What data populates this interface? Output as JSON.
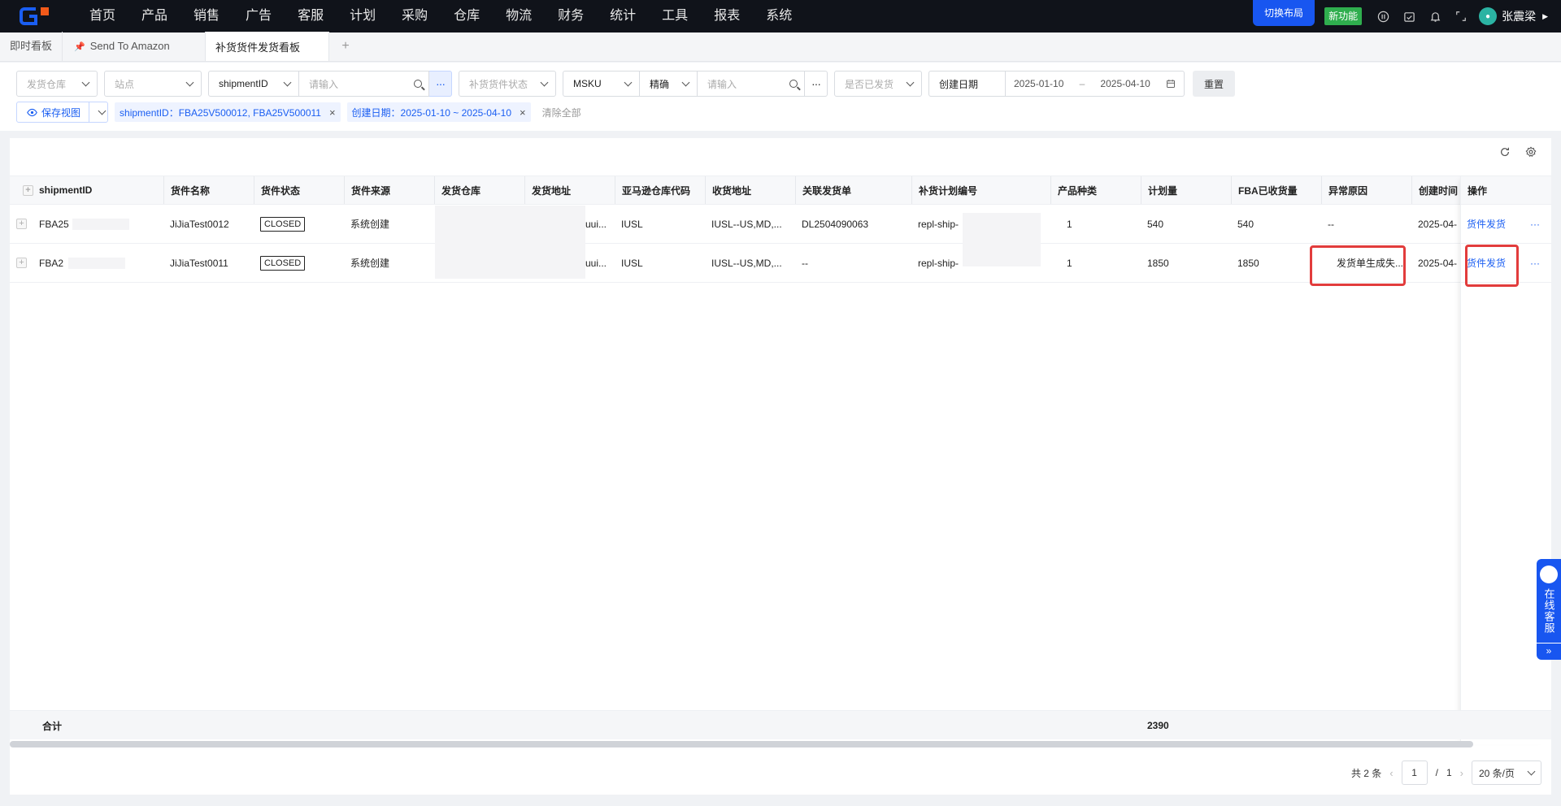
{
  "nav": {
    "items": [
      "首页",
      "产品",
      "销售",
      "广告",
      "客服",
      "计划",
      "采购",
      "仓库",
      "物流",
      "财务",
      "统计",
      "工具",
      "报表",
      "系统"
    ],
    "switch_layout": "切换布局",
    "new_feature": "新功能",
    "user_name": "张震梁"
  },
  "tabs": {
    "items": [
      "即时看板",
      "Send To Amazon",
      "补货货件发货看板"
    ],
    "add": "+"
  },
  "filters": {
    "warehouse_placeholder": "发货仓库",
    "site_placeholder": "站点",
    "shipment_field": "shipmentID",
    "input_placeholder": "请输入",
    "status_placeholder": "补货货件状态",
    "msku_field": "MSKU",
    "match_mode": "精确",
    "input_placeholder2": "请输入",
    "shipped_placeholder": "是否已发货",
    "date_field": "创建日期",
    "date_from": "2025-01-10",
    "date_sep": "–",
    "date_to": "2025-04-10",
    "reset": "重置",
    "save_view": "保存视图",
    "chip1": "shipmentID：FBA25V500012, FBA25V500011",
    "chip2": "创建日期：2025-01-10 ~ 2025-04-10",
    "clear_all": "清除全部"
  },
  "table": {
    "headers": [
      "shipmentID",
      "货件名称",
      "货件状态",
      "货件来源",
      "发货仓库",
      "发货地址",
      "亚马逊仓库代码",
      "收货地址",
      "关联发货单",
      "补货计划编号",
      "产品种类",
      "计划量",
      "FBA已收货量",
      "异常原因",
      "创建时间",
      "操作"
    ],
    "rows": [
      {
        "shipment_id": "FBA25",
        "name": "JiJiaTest0012",
        "status": "CLOSED",
        "source": "系统创建",
        "address_tail": "uui...",
        "fc_code": "IUSL",
        "ship_to": "IUSL--US,MD,...",
        "related_order": "DL2504090063",
        "plan_no": "repl-ship-",
        "sku_types": "1",
        "planned": "540",
        "received": "540",
        "exception": "--",
        "created": "2025-04-",
        "action": "货件发货"
      },
      {
        "shipment_id": "FBA2",
        "name": "JiJiaTest0011",
        "status": "CLOSED",
        "source": "系统创建",
        "address_tail": "uui...",
        "fc_code": "IUSL",
        "ship_to": "IUSL--US,MD,...",
        "related_order": "--",
        "plan_no": "repl-ship-",
        "sku_types": "1",
        "planned": "1850",
        "received": "1850",
        "exception": "发货单生成失...",
        "created": "2025-04-",
        "action": "货件发货"
      }
    ],
    "summary_label": "合计",
    "summary_planned": "2390"
  },
  "pager": {
    "total": "共 2 条",
    "current": "1",
    "sep": "/",
    "pages": "1",
    "page_size": "20 条/页"
  },
  "service": {
    "label": "在线客服",
    "collapse": "»"
  },
  "colors": {
    "accent": "#1a5ef2",
    "nav_bg": "#10131a",
    "highlight": "#e23c3c",
    "new_badge": "#2fae4e"
  }
}
